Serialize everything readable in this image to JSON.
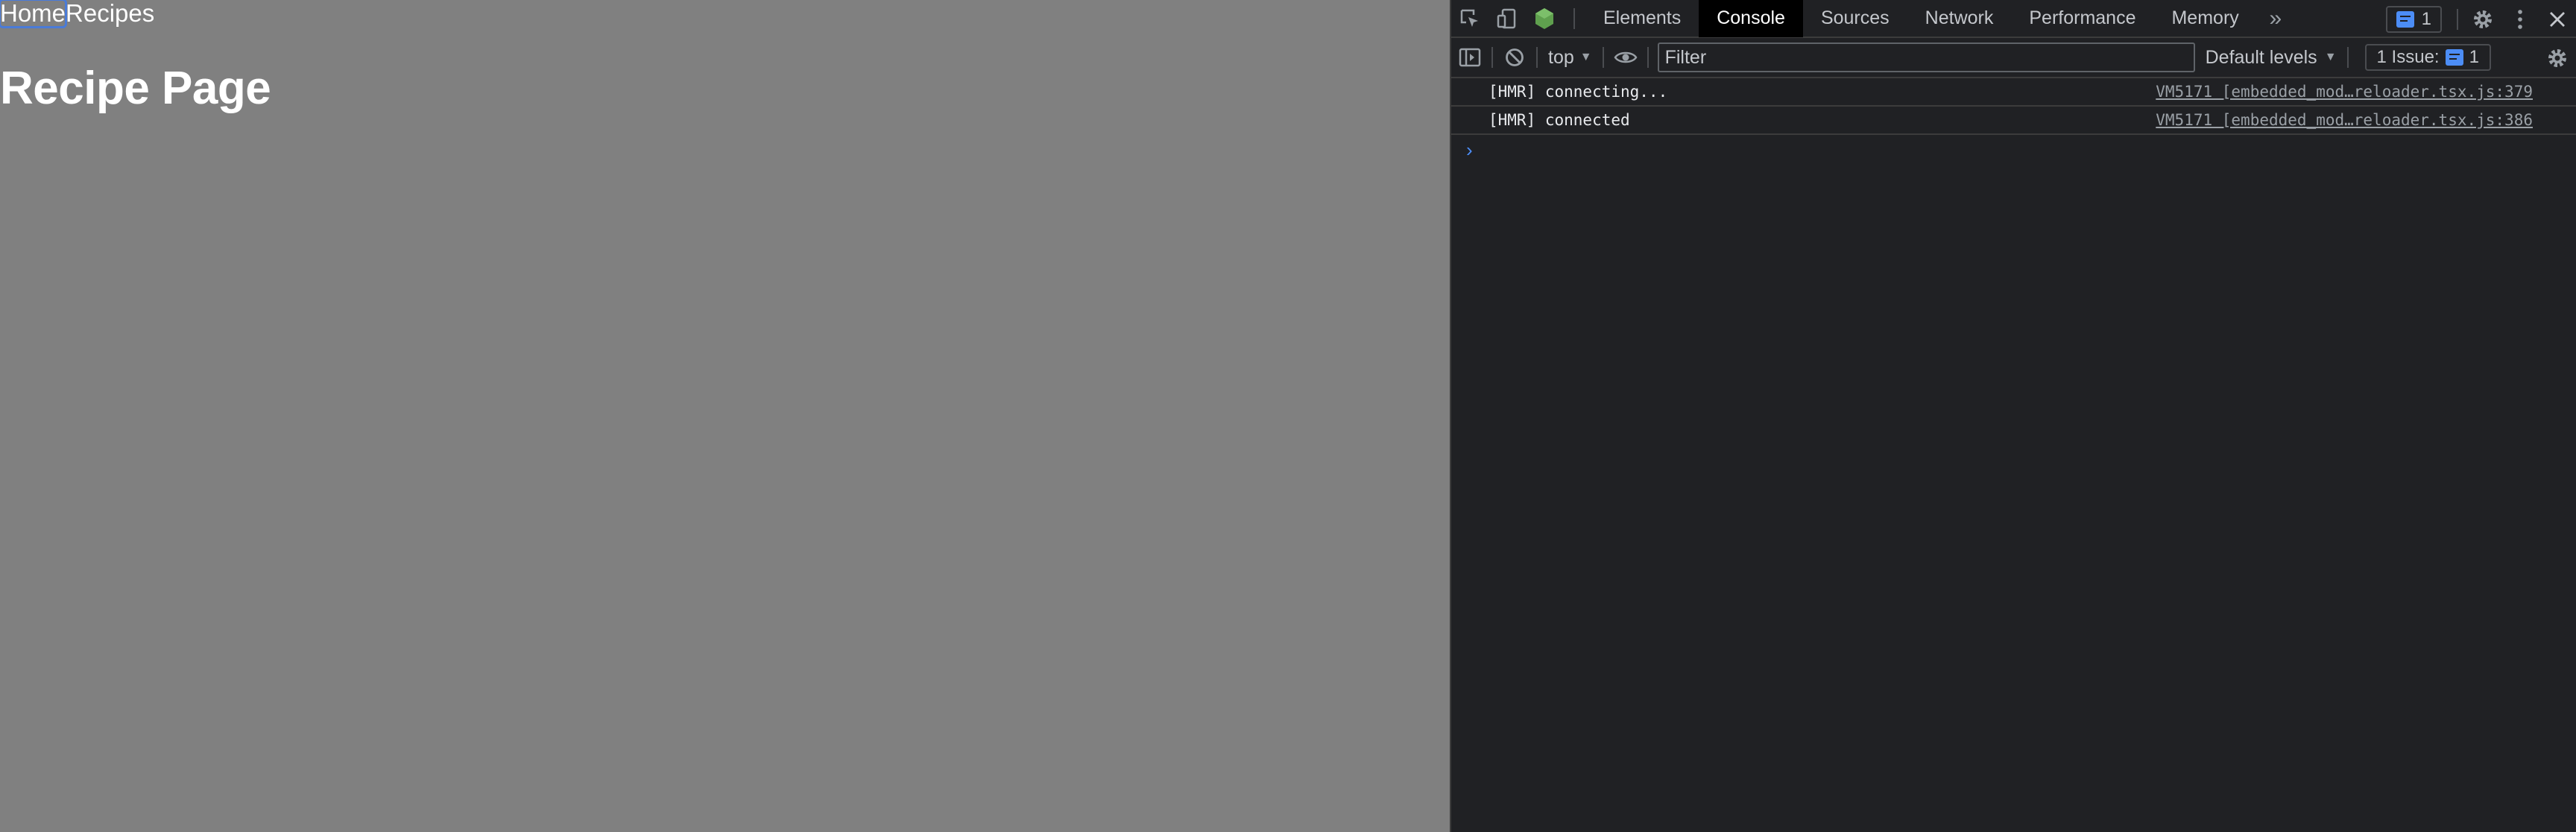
{
  "page": {
    "nav": {
      "home_label": "Home",
      "recipes_label": "Recipes"
    },
    "title": "Recipe Page"
  },
  "devtools": {
    "tabs": [
      "Elements",
      "Console",
      "Sources",
      "Network",
      "Performance",
      "Memory"
    ],
    "active_tab": "Console",
    "more_tabs_icon": "chevron-double-right-icon",
    "issues_badge_count": "1",
    "toolbar": {
      "context": "top",
      "filter_placeholder": "Filter",
      "levels_label": "Default levels",
      "issue_counter_label": "1 Issue:",
      "issue_counter_count": "1"
    },
    "console_messages": [
      {
        "text": "[HMR] connecting...",
        "source": "VM5171 [embedded_mod…reloader.tsx.js:379"
      },
      {
        "text": "[HMR] connected",
        "source": "VM5171 [embedded_mod…reloader.tsx.js:386"
      }
    ],
    "prompt_symbol": "›"
  },
  "colors": {
    "page_background": "#808080",
    "devtools_background": "#202124",
    "accent_blue": "#4c8df6",
    "node_green": "#5fa04e"
  }
}
